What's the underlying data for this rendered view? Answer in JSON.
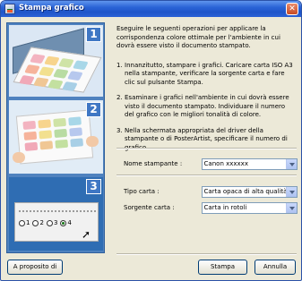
{
  "window": {
    "title": "Stampa grafico",
    "close_label": "✕"
  },
  "illustration": {
    "steps": [
      "1",
      "2",
      "3"
    ],
    "radio_labels": [
      "1",
      "2",
      "3",
      "4"
    ],
    "swatch_colors": [
      "#f3b3c0",
      "#f7d48d",
      "#cfe3a6",
      "#a8d7e8",
      "#f6b39b",
      "#f2e08f",
      "#b9dca3",
      "#b7c8ee",
      "#f1a9b8",
      "#f0c795",
      "#c3e0a0",
      "#a8cfe6"
    ]
  },
  "instructions": {
    "intro": "Eseguire le seguenti operazioni per applicare la corrispondenza colore ottimale per l'ambiente in cui dovrà essere visto il documento stampato.",
    "steps": [
      {
        "num": "1.",
        "text": "Innanzitutto, stampare i grafici. Caricare carta ISO A3 nella stampante, verificare la sorgente carta e fare clic sul pulsante Stampa."
      },
      {
        "num": "2.",
        "text": "Esaminare i grafici nell'ambiente in cui dovrà essere visto il documento stampato. Individuare il numero del grafico con le migliori tonalità di colore."
      },
      {
        "num": "3.",
        "text": "Nella schermata appropriata del driver della stampante o di PosterArtist, specificare il numero di grafico."
      }
    ]
  },
  "form": {
    "printer_label": "Nome stampante :",
    "printer_value": "Canon xxxxxx",
    "type_label": "Tipo carta :",
    "type_value": "Carta opaca di alta qualità",
    "source_label": "Sorgente carta :",
    "source_value": "Carta in rotoli"
  },
  "buttons": {
    "about": "A proposito di",
    "print": "Stampa",
    "cancel": "Annulla"
  }
}
